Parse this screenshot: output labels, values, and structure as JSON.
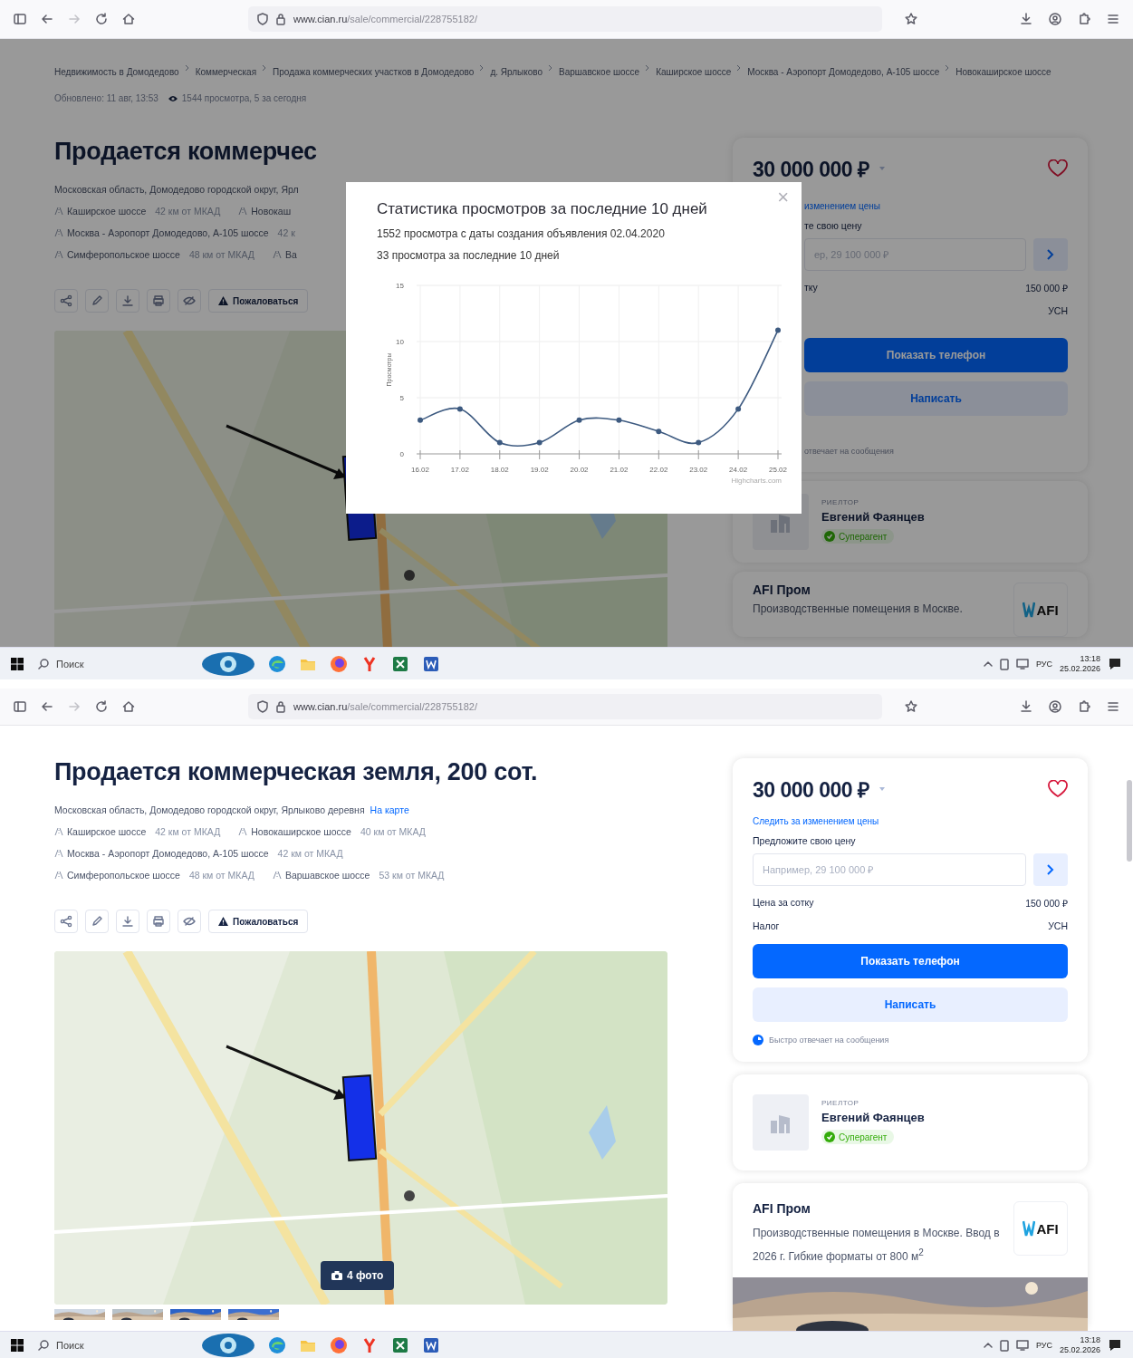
{
  "screens": [
    {
      "browser": {
        "url_host": "www.cian.ru",
        "url_path": "/sale/commercial/228755182/"
      },
      "dimmed": true,
      "breadcrumbs": [
        "Недвижимость в Домодедово",
        "Коммерческая",
        "Продажа коммерческих участков в Домодедово",
        "д. Ярлыково",
        "Варшавское шоссе",
        "Каширское шоссе",
        "Москва - Аэропорт Домодедово, А-105 шоссе",
        "Новокаширское шоссе"
      ],
      "meta": {
        "updated": "Обновлено: 11 авг, 13:53",
        "views": "1544 просмотра, 5 за сегодня"
      },
      "title": "Продается коммерчес",
      "address": "Московская область, Домодедово городской округ, Ярл",
      "highway_rows": [
        [
          {
            "name": "Каширское шоссе",
            "distance": "42 км от МКАД"
          },
          {
            "name": "Новокаш"
          }
        ],
        [
          {
            "name": "Москва - Аэропорт Домодедово, А-105 шоссе",
            "distance": "42 к"
          }
        ],
        [
          {
            "name": "Симферопольское шоссе",
            "distance": "48 км от МКАД"
          },
          {
            "name": "Ва"
          }
        ]
      ],
      "complain_button": "Пожаловаться",
      "offer": {
        "price": "30 000 000 ₽",
        "watch_link": "изменением цены",
        "offer_label": "те свою цену",
        "offer_placeholder": "ер, 29 100 000 ₽",
        "details": [
          {
            "label": "тку",
            "value": "150 000 ₽"
          },
          {
            "value": "УСН"
          }
        ],
        "phone_button": "Показать телефон",
        "write_button": "Написать",
        "reply_note": "отвечает на сообщения"
      },
      "agent": {
        "role": "РИЕЛТОР",
        "name": "Евгений Фаянцев",
        "badge": "Суперагент"
      },
      "ad": {
        "title": "AFI Пром",
        "text": "Производственные помещения в Москве.",
        "logo": "AFI"
      },
      "modal": {
        "title": "Статистика просмотров за последние 10 дней",
        "close": "×",
        "lines": [
          "1552 просмотра с даты создания объявления 02.04.2020",
          "33 просмотра за последние 10 дней"
        ],
        "chart_credit": "Highcharts.com",
        "chart_data": {
          "type": "line",
          "ylabel": "Просмотры",
          "categories": [
            "16.02",
            "17.02",
            "18.02",
            "19.02",
            "20.02",
            "21.02",
            "22.02",
            "23.02",
            "24.02",
            "25.02"
          ],
          "ylim": [
            0,
            15
          ],
          "yticks": [
            0,
            5,
            10,
            15
          ],
          "grid": true,
          "series": [
            {
              "color": "#3d5a80",
              "marker": true,
              "values": [
                3,
                4,
                1,
                1,
                3,
                3,
                2,
                1,
                4,
                11
              ]
            }
          ]
        }
      },
      "taskbar": {
        "search": "Поиск",
        "lang": "РУС",
        "time": "13:18",
        "date": "25.02.2026"
      }
    },
    {
      "browser": {
        "url_host": "www.cian.ru",
        "url_path": "/sale/commercial/228755182/"
      },
      "title": "Продается коммерческая земля, 200 сот.",
      "address": "Московская область, Домодедово городской округ, Ярлыково деревня",
      "map_link": "На карте",
      "highway_rows": [
        [
          {
            "name": "Каширское шоссе",
            "distance": "42 км от МКАД"
          },
          {
            "name": "Новокаширское шоссе",
            "distance": "40 км от МКАД"
          }
        ],
        [
          {
            "name": "Москва - Аэропорт Домодедово, А-105 шоссе",
            "distance": "42 км от МКАД"
          }
        ],
        [
          {
            "name": "Симферопольское шоссе",
            "distance": "48 км от МКАД"
          },
          {
            "name": "Варшавское шоссе",
            "distance": "53 км от МКАД"
          }
        ]
      ],
      "complain_button": "Пожаловаться",
      "photo_button": "4 фото",
      "offer": {
        "price": "30 000 000 ₽",
        "watch_link": "Следить за изменением цены",
        "offer_label": "Предложите свою цену",
        "offer_placeholder": "Например, 29 100 000 ₽",
        "details": [
          {
            "label": "Цена за сотку",
            "value": "150 000 ₽"
          },
          {
            "label": "Налог",
            "value": "УСН"
          }
        ],
        "phone_button": "Показать телефон",
        "write_button": "Написать",
        "reply_note": "Быстро отвечает на сообщения"
      },
      "agent": {
        "role": "РИЕЛТОР",
        "name": "Евгений Фаянцев",
        "badge": "Суперагент"
      },
      "ad": {
        "title": "AFI Пром",
        "text": "Производственные помещения в Москве. Ввод в 2026 г. Гибкие форматы от 800 м$^{2}$",
        "logo": "AFI"
      },
      "taskbar": {
        "search": "Поиск",
        "lang": "РУС",
        "time": "13:18",
        "date": "25.02.2026"
      }
    }
  ]
}
